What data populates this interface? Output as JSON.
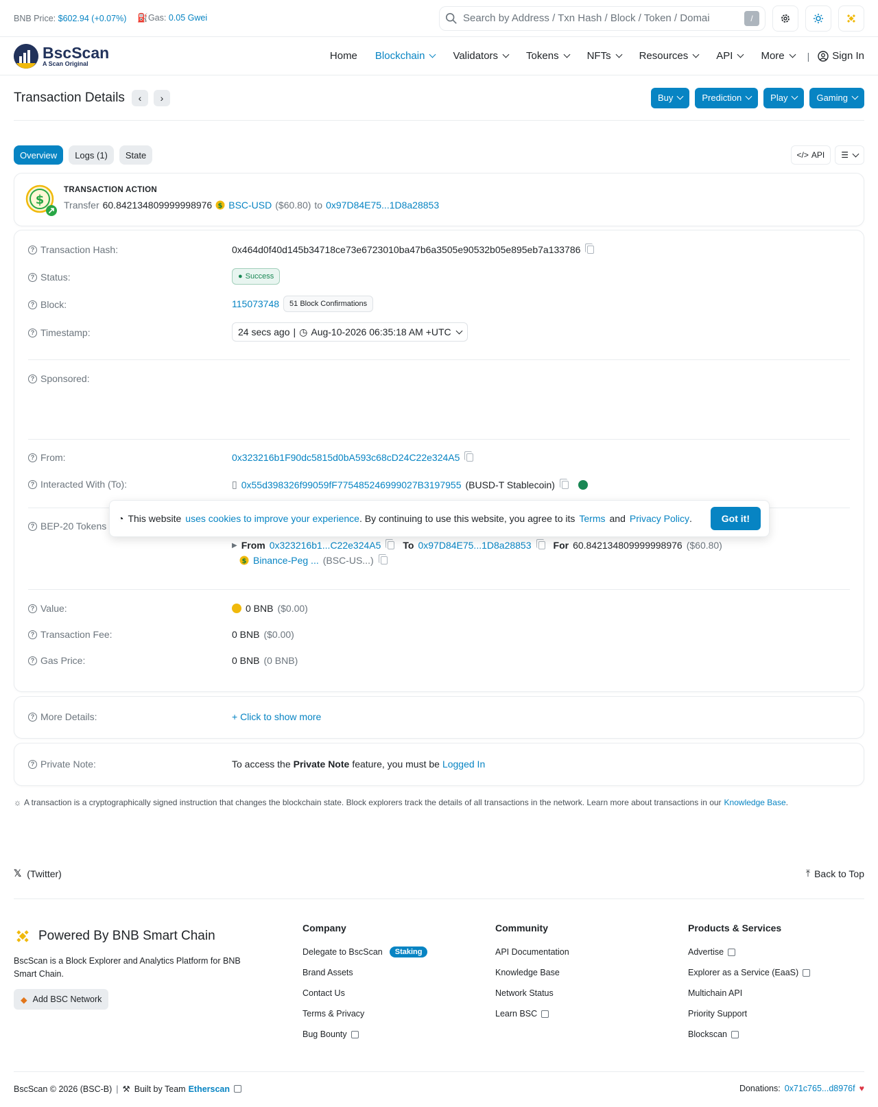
{
  "topbar": {
    "bnb_label": "BNB Price:",
    "bnb_price": "$602.94 (+0.07%)",
    "gas_label": "Gas:",
    "gas_value": "0.05 Gwei",
    "search_placeholder": "Search by Address / Txn Hash / Block / Token / Domai",
    "slash": "/"
  },
  "nav": {
    "logo_name": "BscScan",
    "logo_sub": "A Scan Original",
    "items": [
      "Home",
      "Blockchain",
      "Validators",
      "Tokens",
      "NFTs",
      "Resources",
      "API",
      "More"
    ],
    "sign_in": "Sign In"
  },
  "page": {
    "title": "Transaction Details",
    "buttons": [
      "Buy",
      "Prediction",
      "Play",
      "Gaming"
    ]
  },
  "tabs": [
    "Overview",
    "Logs (1)",
    "State"
  ],
  "right_buttons": {
    "api": "API"
  },
  "action": {
    "title": "TRANSACTION ACTION",
    "transfer": "Transfer",
    "amount": "60.842134809999998976",
    "token": "BSC-USD",
    "usd": "($60.80)",
    "to": "to",
    "to_addr": "0x97D84E75...1D8a28853"
  },
  "details": {
    "hash_label": "Transaction Hash:",
    "hash": "0x464d0f40d145b34718ce73e6723010ba47b6a3505e90532b05e895eb7a133786",
    "status_label": "Status:",
    "status": "Success",
    "block_label": "Block:",
    "block": "115073748",
    "confirmations": "51 Block Confirmations",
    "timestamp_label": "Timestamp:",
    "timestamp_ago": "24 secs ago",
    "timestamp_sep": "|",
    "timestamp": "Aug-10-2026 06:35:18 AM +UTC",
    "sponsored_label": "Sponsored:",
    "from_label": "From:",
    "from": "0x323216b1F90dc5815d0bA593c68cD24C22e324A5",
    "to_label": "Interacted With (To):",
    "to_addr": "0x55d398326f99059fF775485246999027B3197955",
    "to_name": "(BUSD-T Stablecoin)",
    "tokens_label": "BEP-20 Tokens",
    "tt_from": "From",
    "tt_from_addr": "0x323216b1...C22e324A5",
    "tt_to": "To",
    "tt_to_addr": "0x97D84E75...1D8a28853",
    "tt_for": "For",
    "tt_amount": "60.842134809999998976",
    "tt_usd": "($60.80)",
    "tt_token": "Binance-Peg ...",
    "tt_token_sym": "(BSC-US...)",
    "value_label": "Value:",
    "value": "0 BNB",
    "value_usd": "($0.00)",
    "fee_label": "Transaction Fee:",
    "fee": "0 BNB",
    "fee_usd": "($0.00)",
    "gas_label": "Gas Price:",
    "gas": "0 BNB",
    "gas_sub": "(0 BNB)",
    "more_label": "More Details:",
    "more": "+ Click to show more",
    "note_label": "Private Note:",
    "note_pre": "To access the",
    "note_bold": "Private Note",
    "note_mid": "feature, you must be",
    "note_link": "Logged In"
  },
  "info": {
    "text": "A transaction is a cryptographically signed instruction that changes the blockchain state. Block explorers track the details of all transactions in the network. Learn more about transactions in our",
    "link": "Knowledge Base",
    "end": "."
  },
  "cookie": {
    "pre": "This website",
    "link1": "uses cookies to improve your experience",
    "mid": ". By continuing to use this website, you agree to its",
    "terms": "Terms",
    "and": "and",
    "privacy": "Privacy Policy",
    "end": ".",
    "button": "Got it!"
  },
  "footer": {
    "twitter": "(Twitter)",
    "back_top": "Back to Top",
    "powered": "Powered By BNB Smart Chain",
    "desc": "BscScan is a Block Explorer and Analytics Platform for BNB Smart Chain.",
    "add_network": "Add BSC Network",
    "company_title": "Company",
    "company": [
      "Delegate to BscScan",
      "Brand Assets",
      "Contact Us",
      "Terms & Privacy",
      "Bug Bounty"
    ],
    "staking": "Staking",
    "community_title": "Community",
    "community": [
      "API Documentation",
      "Knowledge Base",
      "Network Status",
      "Learn BSC"
    ],
    "products_title": "Products & Services",
    "products": [
      "Advertise",
      "Explorer as a Service (EaaS)",
      "Multichain API",
      "Priority Support",
      "Blockscan"
    ],
    "copyright": "BscScan © 2026 (BSC-B)",
    "built": "Built by Team",
    "etherscan": "Etherscan",
    "donations": "Donations:",
    "donation_addr": "0x71c765...d8976f"
  },
  "colors": {
    "accent": "#0784c3",
    "success": "#198754",
    "bnb": "#f0b90b"
  }
}
